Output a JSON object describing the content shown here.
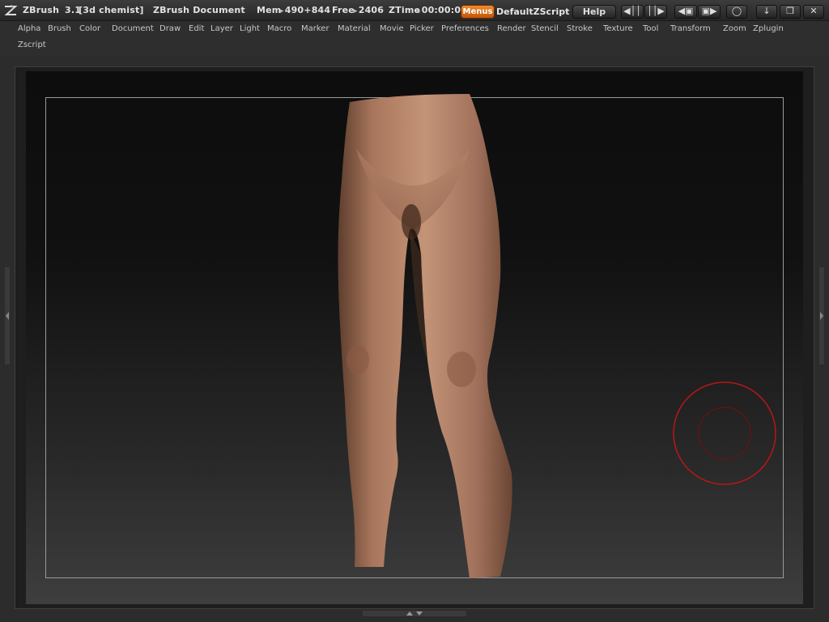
{
  "titlebar": {
    "app_name": "ZBrush",
    "version": "3.1",
    "user": "[3d chemist]",
    "document": "ZBrush Document",
    "mem_label": "Mem",
    "mem_value": "490+844",
    "free_label": "Free",
    "free_value": "2406",
    "ztime_label": "ZTime",
    "ztime_value": "00:00:0",
    "menus_button": "Menus",
    "zscript_button": "DefaultZScript",
    "help_button": "Help"
  },
  "menu": {
    "items": [
      "Alpha",
      "Brush",
      "Color",
      "Document",
      "Draw",
      "Edit",
      "Layer",
      "Light",
      "Macro",
      "Marker",
      "Material",
      "Movie",
      "Picker",
      "Preferences",
      "Render",
      "Stencil",
      "Stroke",
      "Texture",
      "Tool",
      "Transform",
      "Zoom",
      "Zplugin"
    ],
    "row2": [
      "Zscript"
    ]
  },
  "colors": {
    "accent_orange": "#e8771a",
    "brush_ring": "#b01818",
    "skin": "#a8765c",
    "canvas_top": "#0d0d0d",
    "canvas_bottom": "#3e3e3e"
  },
  "icons": [
    "zbrush-logo-icon",
    "scroll-left-icon",
    "scroll-right-icon",
    "palette-left-icon",
    "palette-right-icon",
    "lock-icon",
    "minimize-icon",
    "restore-icon",
    "close-icon"
  ]
}
